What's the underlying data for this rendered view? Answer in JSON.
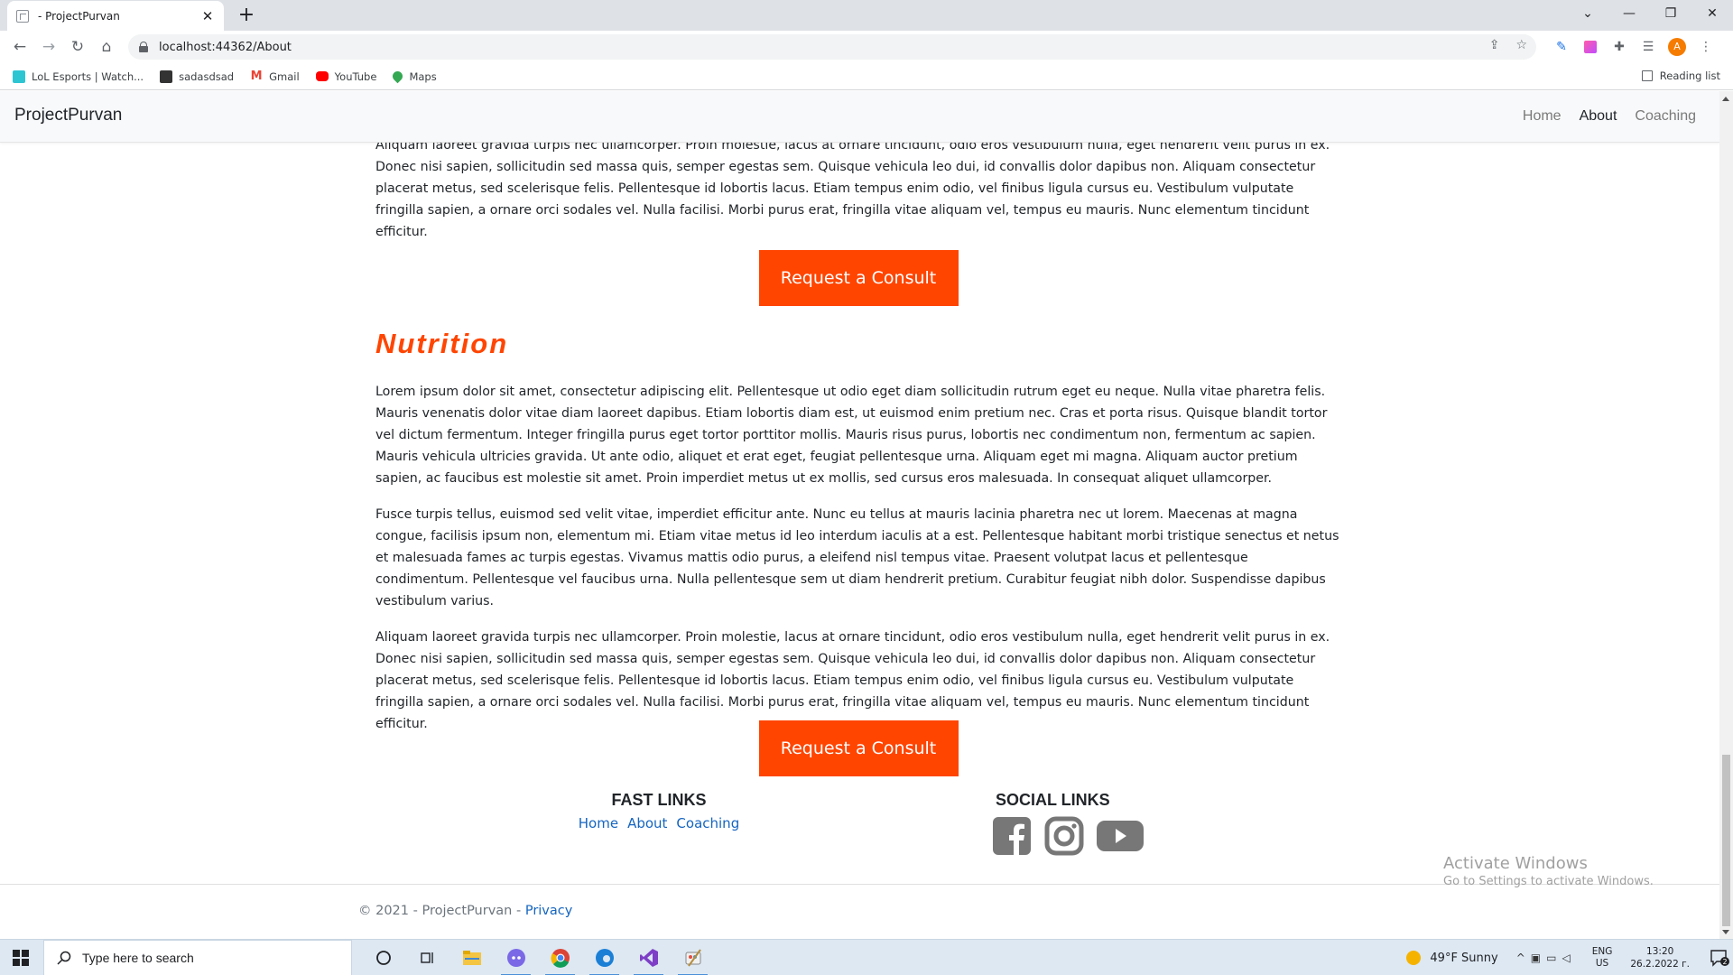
{
  "browser": {
    "tab_title": " - ProjectPurvan",
    "tab_close": "✕",
    "new_tab": "+",
    "url": "localhost:44362/About",
    "bookmarks": [
      {
        "label": "LoL Esports | Watch...",
        "color": "#2ec5d3"
      },
      {
        "label": "sadasdsad",
        "color": "#333333"
      },
      {
        "label": "Gmail",
        "color": "#ea4335"
      },
      {
        "label": "YouTube",
        "color": "#ff0000"
      },
      {
        "label": "Maps",
        "color": "#34a853"
      }
    ],
    "reading_list": "Reading list",
    "avatar_letter": "A"
  },
  "site": {
    "brand": "ProjectPurvan",
    "nav": {
      "home": "Home",
      "about": "About",
      "coaching": "Coaching"
    }
  },
  "content": {
    "top_partial_paragraph": "Aliquam laoreet gravida turpis nec ullamcorper. Proin molestie, lacus at ornare tincidunt, odio eros vestibulum nulla, eget hendrerit velit purus in ex. Donec nisi sapien, sollicitudin sed massa quis, semper egestas sem. Quisque vehicula leo dui, id convallis dolor dapibus non. Aliquam consectetur placerat metus, sed scelerisque felis. Pellentesque id lobortis lacus. Etiam tempus enim odio, vel finibus ligula cursus eu. Vestibulum vulputate fringilla sapien, a ornare orci sodales vel. Nulla facilisi. Morbi purus erat, fringilla vitae aliquam vel, tempus eu mauris. Nunc elementum tincidunt efficitur.",
    "cta_label": "Request a Consult",
    "section_title": "Nutrition",
    "paragraphs": [
      "Lorem ipsum dolor sit amet, consectetur adipiscing elit. Pellentesque ut odio eget diam sollicitudin rutrum eget eu neque. Nulla vitae pharetra felis. Mauris venenatis dolor vitae diam laoreet dapibus. Etiam lobortis diam est, ut euismod enim pretium nec. Cras et porta risus. Quisque blandit tortor vel dictum fermentum. Integer fringilla purus eget tortor porttitor mollis. Mauris risus purus, lobortis nec condimentum non, fermentum ac sapien. Mauris vehicula ultricies gravida. Ut ante odio, aliquet et erat eget, feugiat pellentesque urna. Aliquam eget mi magna. Aliquam auctor pretium sapien, ac faucibus est molestie sit amet. Proin imperdiet metus ut ex mollis, sed cursus eros malesuada. In consequat aliquet ullamcorper.",
      "Fusce turpis tellus, euismod sed velit vitae, imperdiet efficitur ante. Nunc eu tellus at mauris lacinia pharetra nec ut lorem. Maecenas at magna congue, facilisis ipsum non, elementum mi. Etiam vitae metus id leo interdum iaculis at a est. Pellentesque habitant morbi tristique senectus et netus et malesuada fames ac turpis egestas. Vivamus mattis odio purus, a eleifend nisl tempus vitae. Praesent volutpat lacus et pellentesque condimentum. Pellentesque vel faucibus urna. Nulla pellentesque sem ut diam hendrerit pretium. Curabitur feugiat nibh dolor. Suspendisse dapibus vestibulum varius.",
      "Aliquam laoreet gravida turpis nec ullamcorper. Proin molestie, lacus at ornare tincidunt, odio eros vestibulum nulla, eget hendrerit velit purus in ex. Donec nisi sapien, sollicitudin sed massa quis, semper egestas sem. Quisque vehicula leo dui, id convallis dolor dapibus non. Aliquam consectetur placerat metus, sed scelerisque felis. Pellentesque id lobortis lacus. Etiam tempus enim odio, vel finibus ligula cursus eu. Vestibulum vulputate fringilla sapien, a ornare orci sodales vel. Nulla facilisi. Morbi purus erat, fringilla vitae aliquam vel, tempus eu mauris. Nunc elementum tincidunt efficitur."
    ]
  },
  "footer": {
    "fast_links_title": "FAST LINKS",
    "fast_links": {
      "home": "Home",
      "about": "About",
      "coaching": "Coaching"
    },
    "social_links_title": "SOCIAL LINKS",
    "social_icons": [
      "facebook-icon",
      "instagram-icon",
      "youtube-icon"
    ],
    "copyright": "© 2021 - ProjectPurvan - ",
    "privacy": "Privacy"
  },
  "watermark": {
    "line1": "Activate Windows",
    "line2": "Go to Settings to activate Windows."
  },
  "taskbar": {
    "search_placeholder": "Type here to search",
    "weather": "49°F  Sunny",
    "lang_1": "ENG",
    "lang_2": "US",
    "time": "13:20",
    "date": "26.2.2022 г.",
    "notification_count": "2"
  },
  "colors": {
    "accent": "#ff4500",
    "link": "#1565c0",
    "social_icon": "#777777"
  }
}
